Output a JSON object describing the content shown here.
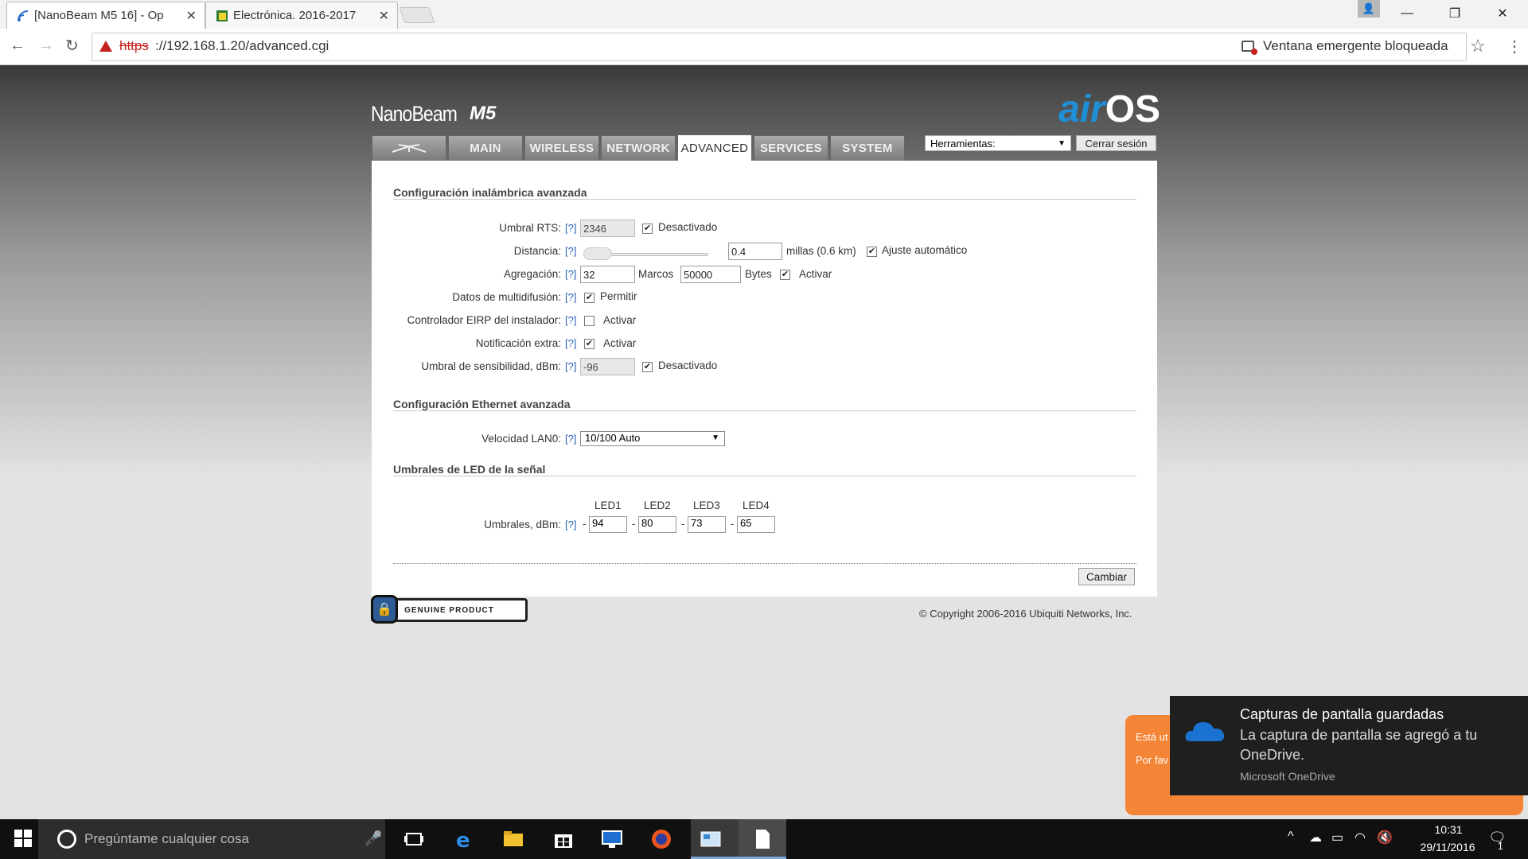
{
  "browser": {
    "tabs": [
      {
        "title": "[NanoBeam M5 16] - Op",
        "active": true
      },
      {
        "title": "Electrónica. 2016-2017",
        "active": false
      }
    ],
    "url_scheme": "https",
    "url_rest": "://192.168.1.20/advanced.cgi",
    "popup_blocked": "Ventana emergente bloqueada",
    "window_controls": [
      "minimize",
      "restore",
      "close"
    ]
  },
  "device": {
    "brand": "NanoBeam",
    "model": "M5",
    "logo": "airOS",
    "logo_air": "air",
    "logo_os": "OS"
  },
  "tabs": [
    {
      "label": "",
      "icon": "ubiquiti-logo-icon"
    },
    {
      "label": "MAIN"
    },
    {
      "label": "WIRELESS"
    },
    {
      "label": "NETWORK"
    },
    {
      "label": "ADVANCED",
      "selected": true
    },
    {
      "label": "SERVICES"
    },
    {
      "label": "SYSTEM"
    }
  ],
  "tools": {
    "label": "Herramientas:",
    "logout": "Cerrar sesión"
  },
  "help": "[?]",
  "wireless_section": {
    "title": "Configuración inalámbrica avanzada",
    "rts": {
      "label": "Umbral RTS:",
      "value": "2346",
      "checkbox_label": "Desactivado",
      "checked": true
    },
    "distance": {
      "label": "Distancia:",
      "value": "0.4",
      "unit": "millas (0.6 km)",
      "auto_label": "Ajuste automático",
      "auto_checked": true,
      "slider_level": 0.0
    },
    "aggregation": {
      "label": "Agregación:",
      "frames_value": "32",
      "frames_unit": "Marcos",
      "bytes_value": "50000",
      "bytes_unit": "Bytes",
      "enable_label": "Activar",
      "checked": true
    },
    "multicast": {
      "label": "Datos de multidifusión:",
      "checkbox_label": "Permitir",
      "checked": true
    },
    "eirp": {
      "label": "Controlador EIRP del instalador:",
      "checkbox_label": "Activar",
      "checked": false
    },
    "extra_notification": {
      "label": "Notificación extra:",
      "checkbox_label": "Activar",
      "checked": true
    },
    "sensitivity": {
      "label": "Umbral de sensibilidad, dBm:",
      "value": "-96",
      "checkbox_label": "Desactivado",
      "checked": true
    }
  },
  "ethernet_section": {
    "title": "Configuración Ethernet avanzada",
    "lan_speed": {
      "label": "Velocidad LAN0:",
      "value": "10/100 Auto"
    }
  },
  "led_section": {
    "title": "Umbrales de LED de la señal",
    "label": "Umbrales, dBm:",
    "headers": [
      "LED1",
      "LED2",
      "LED3",
      "LED4"
    ],
    "values": [
      "94",
      "80",
      "73",
      "65"
    ]
  },
  "apply_button": "Cambiar",
  "genuine_badge": "GENUINE PRODUCT",
  "copyright": "© Copyright 2006-2016 Ubiquiti Networks, Inc.",
  "orange_notice": {
    "line1": "Está ut",
    "line2": "Por fav"
  },
  "toast": {
    "title": "Capturas de pantalla guardadas",
    "body": "La captura de pantalla se agregó a tu OneDrive.",
    "source": "Microsoft OneDrive"
  },
  "taskbar": {
    "search_placeholder": "Pregúntame cualquier cosa",
    "time": "10:31",
    "date": "29/11/2016",
    "notification_count": "1"
  },
  "colors": {
    "accent_blue": "#1f8fd6",
    "link_blue": "#2962b6",
    "warning_red": "#c5221f",
    "orange": "#f58536"
  }
}
